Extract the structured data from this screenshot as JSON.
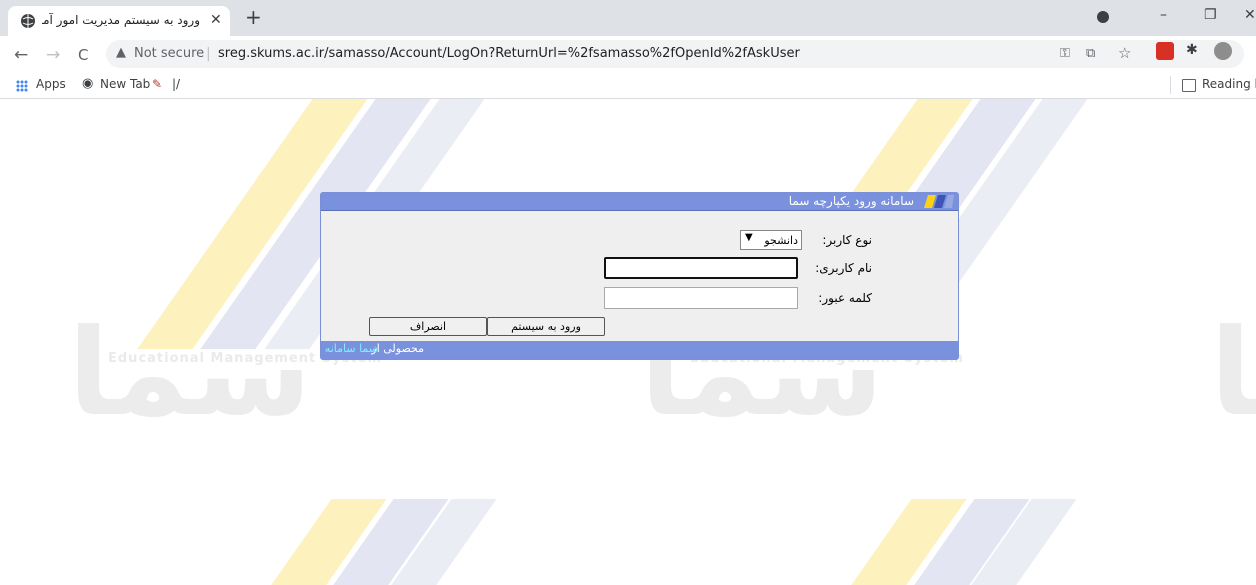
{
  "browser": {
    "tab_title": "ورود به سیستم مدیریت امور آموزش",
    "new_tab_symbol": "+",
    "close_symbol": "✕",
    "window_controls": {
      "minimize": "–",
      "restore": "❐",
      "close": "✕"
    },
    "nav": {
      "back": "←",
      "forward": "→",
      "reload": "C"
    },
    "security_label": "Not secure",
    "url": "sreg.skums.ac.ir/samasso/Account/LogOn?ReturnUrl=%2fsamasso%2fOpenId%2fAskUser",
    "bookmarks": [
      {
        "label": "Apps",
        "icon": "apps-grid-icon"
      },
      {
        "label": "New Tab",
        "icon": "globe-icon"
      },
      {
        "label": "|/",
        "icon": "bookmark-favicon-icon"
      }
    ],
    "reading_list_label": "Reading lis",
    "extension_colors": {
      "pdf": "#d93025",
      "puzzle": "#3c4043"
    }
  },
  "page": {
    "watermark": {
      "logo_text": "سما",
      "tagline": "Educational Management System",
      "stripe_colors": {
        "yellow": "#fdf0b8",
        "blue": "#e2e6f3"
      }
    },
    "login": {
      "header_title": "سامانه ورود یکپارچه سما",
      "user_type_label": "نوع کاربر:",
      "user_type_value": "دانشجو",
      "username_label": "نام کاربری:",
      "username_value": "",
      "password_label": "کلمه عبور:",
      "password_value": "",
      "login_button": "ورود به سیستم",
      "cancel_button": "انصراف",
      "footer_text": "محصولی از",
      "footer_link": "سما سامانه"
    }
  }
}
